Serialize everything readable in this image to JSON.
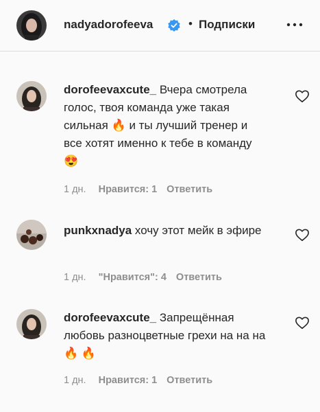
{
  "header": {
    "username": "nadyadorofeeva",
    "dot": "•",
    "follow_label": "Подписки",
    "avatar_icon": "profile-photo",
    "verified_icon": "verified-badge-icon",
    "more_icon": "more-options-icon",
    "verified_color": "#3897f0"
  },
  "comments": [
    {
      "username": "dorofeevaxcute_",
      "text_parts": [
        " Вчера смотрела голос, твоя команда уже такая сильная ",
        "🔥",
        " и ты лучший тренер и все хотят именно к тебе в команду",
        "😍"
      ],
      "time": "1 дн.",
      "likes": "Нравится: 1",
      "reply": "Ответить"
    },
    {
      "username": "punkxnadya",
      "text_parts": [
        " хочу этот мейк в эфире"
      ],
      "time": "1 дн.",
      "likes": "\"Нравится\": 4",
      "reply": "Ответить"
    },
    {
      "username": "dorofeevaxcute_",
      "text_parts": [
        " Запрещённая любовь разноцветные грехи на на на ",
        "🔥",
        " ",
        "🔥"
      ],
      "time": "1 дн.",
      "likes": "Нравится: 1",
      "reply": "Ответить"
    }
  ]
}
